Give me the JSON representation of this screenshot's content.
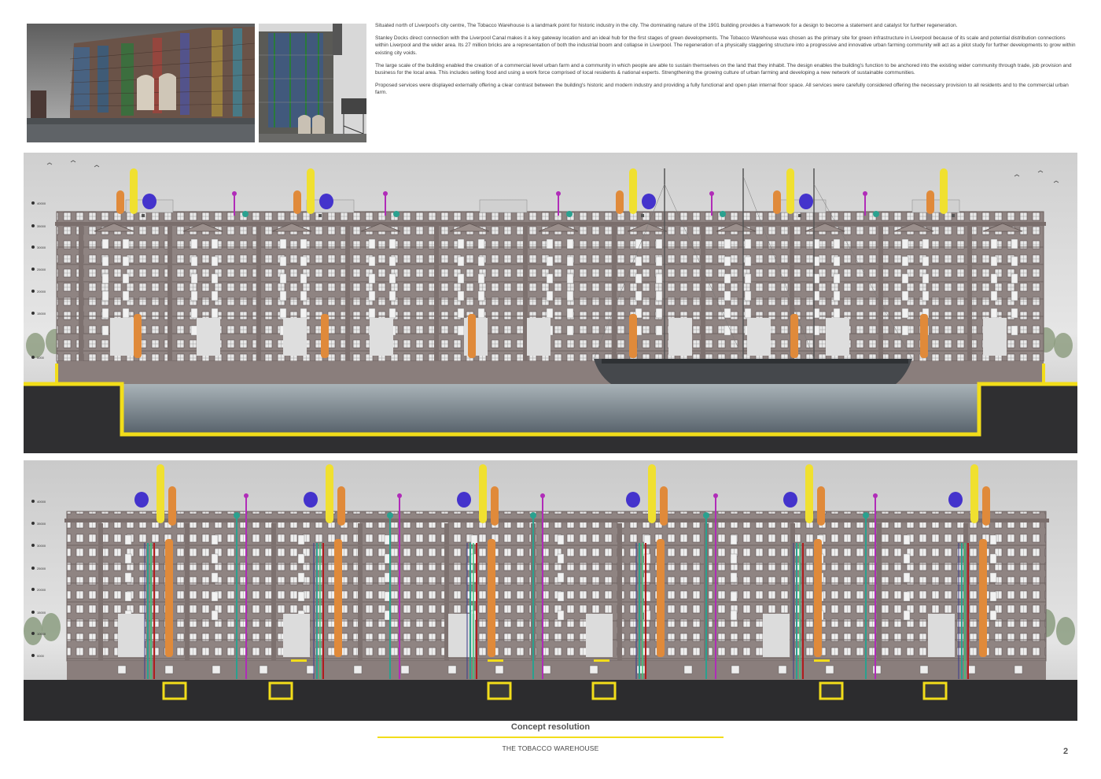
{
  "intro": {
    "paragraphs": [
      "Situated north of Liverpool's city centre, The Tobacco Warehouse is a landmark point for historic industry in the city. The dominating nature of the 1901 building provides a framework for a design to become a statement and catalyst for further regeneration.",
      "Stanley Docks direct connection with the Liverpool Canal makes it a key gateway location and an ideal hub for the first stages of green developments. The Tobacco Warehouse was chosen as the primary site for green infrastructure in Liverpool because of its scale and potential distribution connections within Liverpool and the wider area. Its 27 million bricks are a representation of both the industrial boom and collapse in Liverpool.  The regeneration of a physically staggering structure into a progressive and innovative urban farming community will act as a pilot study for further developments to grow within existing city voids.",
      "The large scale of the building enabled the creation of a commercial level urban farm and a community in which people are able to sustain themselves on the land that they inhabit. The design enables the building's function to be anchored into the existing wider community through trade, job provision and business for the local area. This includes selling food and using a work force comprised of local residents & national experts. Strengthening the growing culture of urban farming and developing a new network of sustainable communities.",
      "Proposed services were displayed externally offering a clear contrast between the building's historic and modern industry and providing a fully functional and open plan internal floor space. All services were carefully considered offering the necessary provision to all residents and to the commercial urban farm."
    ]
  },
  "elevation_upper": {
    "levels": [
      "40000",
      "35000",
      "30000",
      "25000",
      "20000",
      "15000",
      "0000"
    ]
  },
  "elevation_lower": {
    "levels": [
      "40000",
      "35000",
      "30000",
      "25000",
      "20000",
      "15000",
      "10000",
      "0000"
    ]
  },
  "footer": {
    "title": "Concept resolution",
    "subtitle": "THE TOBACCO WAREHOUSE",
    "page_number": "2"
  },
  "colors": {
    "accent_yellow": "#f2dd1a",
    "brick": "#8e8280",
    "pipe_yellow": "#f0e030",
    "pipe_orange": "#e08a3a",
    "pipe_blue": "#4433cc",
    "pipe_purple": "#b02cb8",
    "pipe_teal": "#2aa18f",
    "pipe_red": "#b01c1c"
  }
}
